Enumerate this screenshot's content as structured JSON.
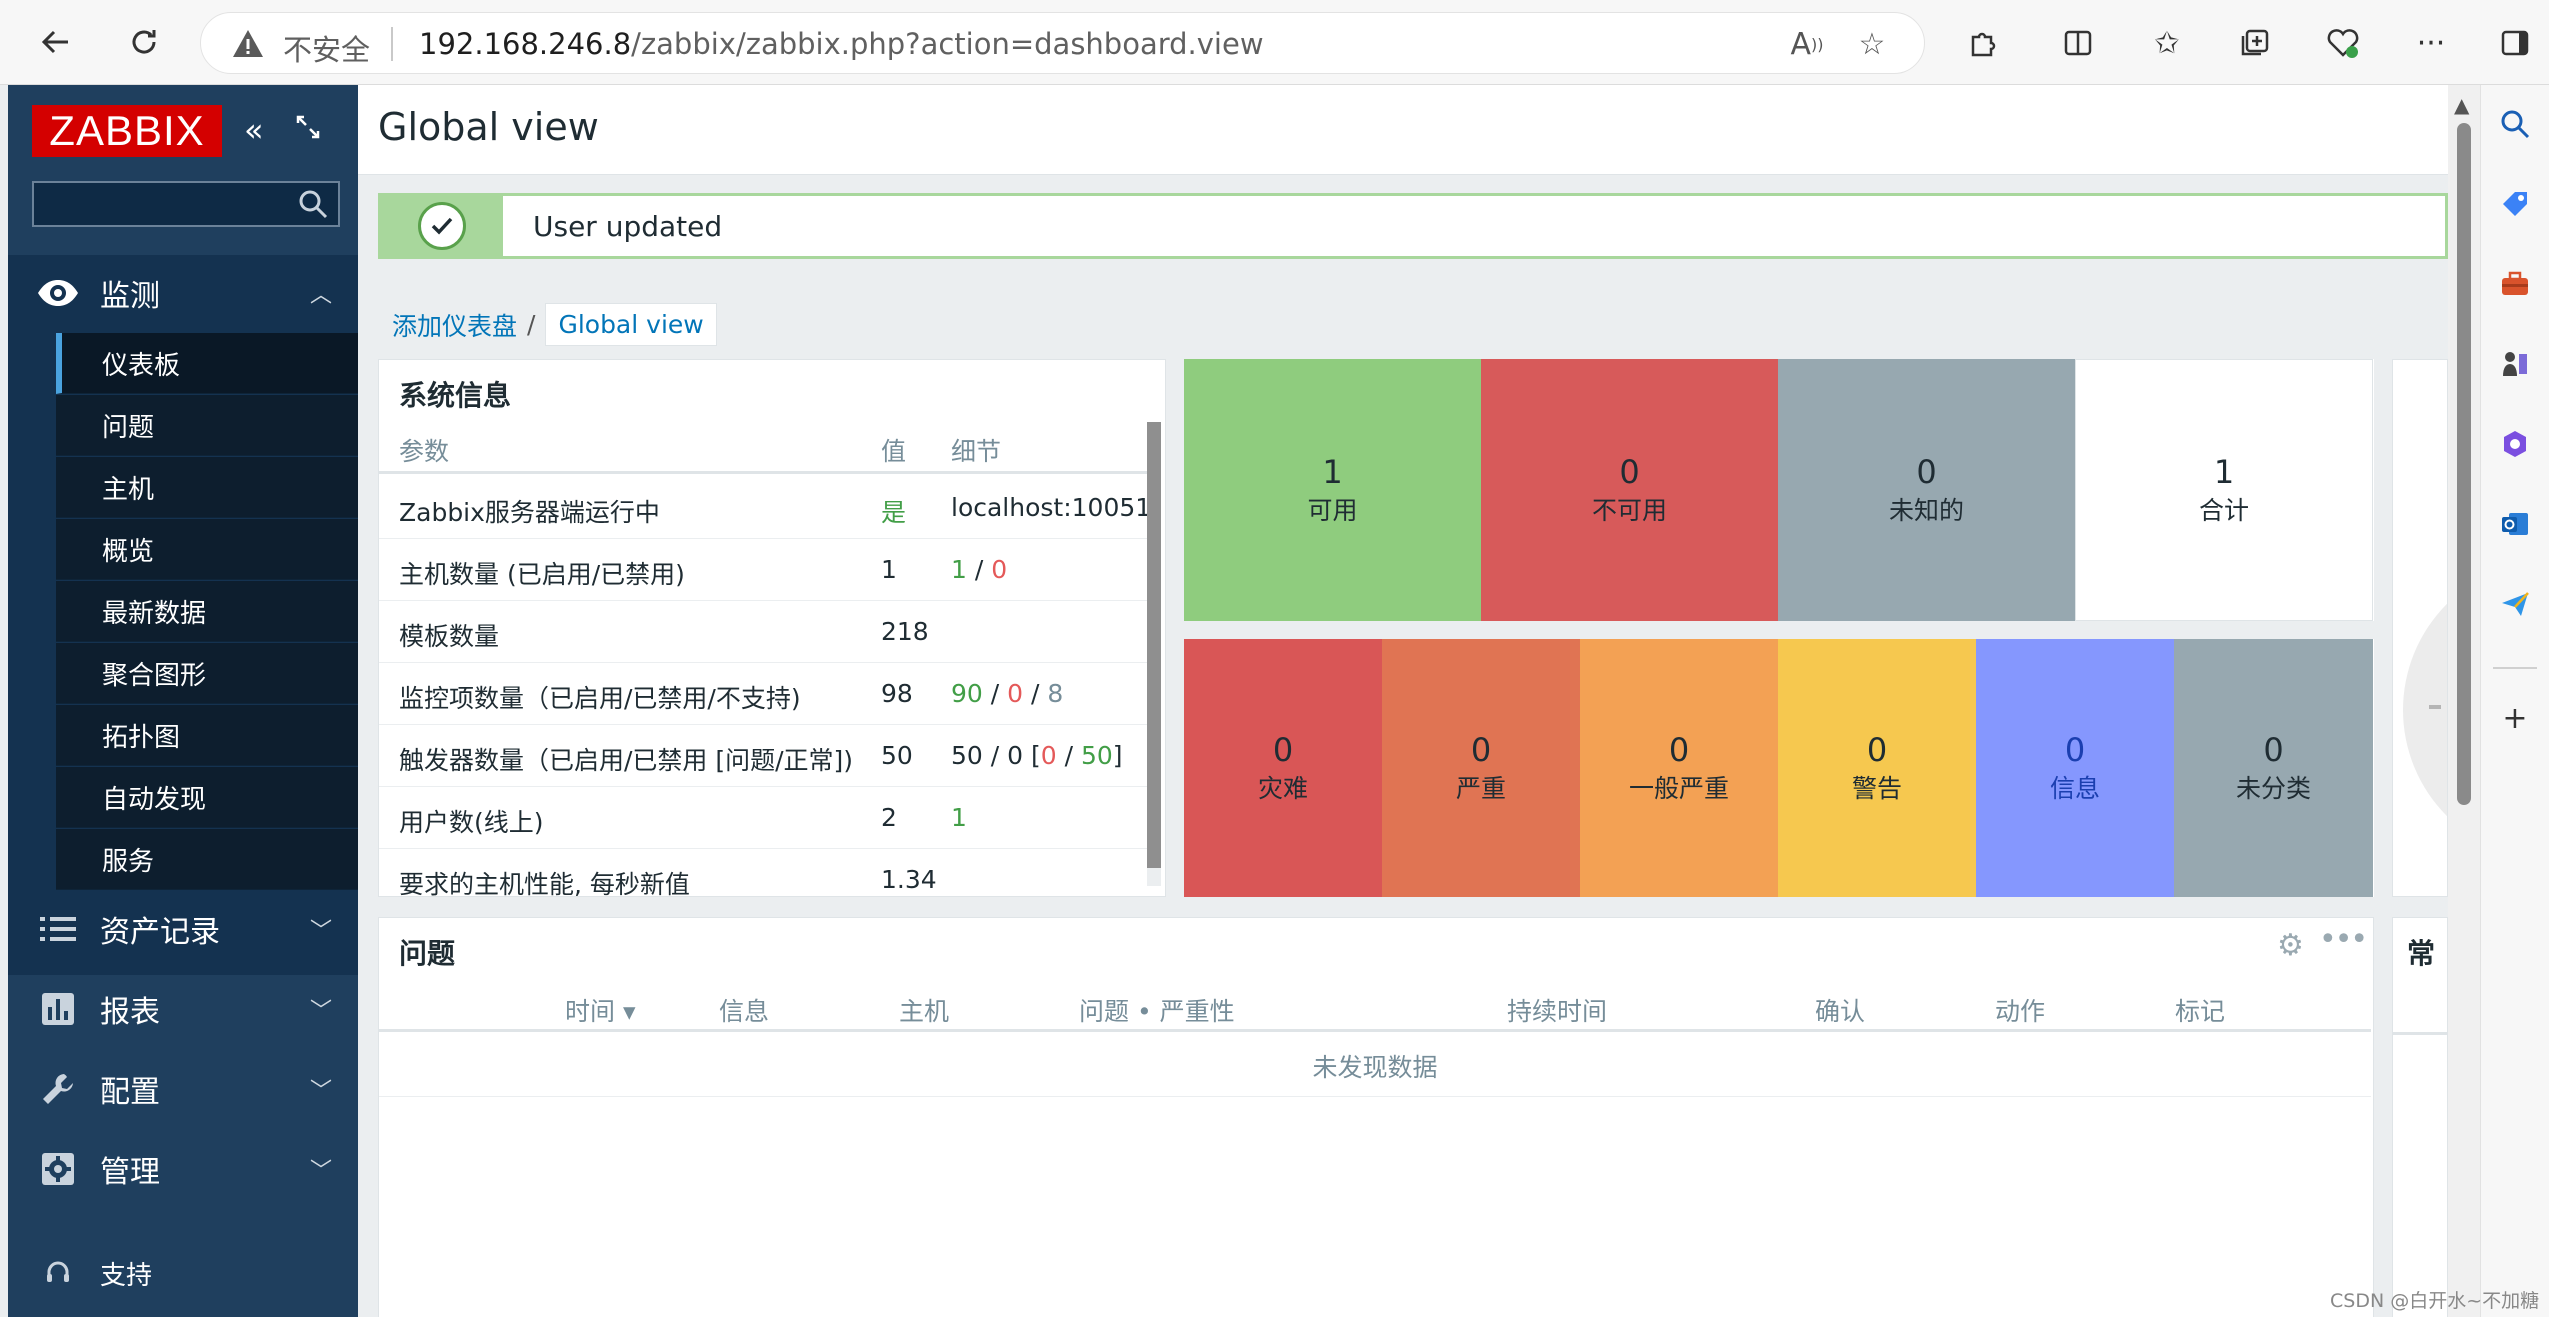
{
  "browser": {
    "insecure_label": "不安全",
    "url_host": "192.168.246.8",
    "url_path": "/zabbix/zabbix.php?action=dashboard.view"
  },
  "sidebar": {
    "logo": "ZABBIX",
    "search_placeholder": "",
    "sections": [
      {
        "label": "监测",
        "icon": "eye-icon",
        "expanded": true
      },
      {
        "label": "资产记录",
        "icon": "list-icon"
      },
      {
        "label": "报表",
        "icon": "bar-chart-icon"
      },
      {
        "label": "配置",
        "icon": "wrench-icon"
      },
      {
        "label": "管理",
        "icon": "gear-icon"
      }
    ],
    "monitor_items": [
      "仪表板",
      "问题",
      "主机",
      "概览",
      "最新数据",
      "聚合图形",
      "拓扑图",
      "自动发现",
      "服务"
    ],
    "support": "支持"
  },
  "header": {
    "title": "Global view"
  },
  "message": {
    "text": "User updated"
  },
  "breadcrumb": {
    "parent": "添加仪表盘",
    "current": "Global view"
  },
  "system_info": {
    "title": "系统信息",
    "columns": [
      "参数",
      "值",
      "细节"
    ],
    "rows": [
      {
        "param": "Zabbix服务器端运行中",
        "value": "是",
        "detail": "localhost:10051"
      },
      {
        "param": "主机数量 (已启用/已禁用)",
        "value": "1",
        "d1": "1",
        "d2": "0"
      },
      {
        "param": "模板数量",
        "value": "218"
      },
      {
        "param": "监控项数量（已启用/已禁用/不支持)",
        "value": "98",
        "d1": "90",
        "d2": "0",
        "d3": "8"
      },
      {
        "param": "触发器数量（已启用/已禁用 [问题/正常])",
        "value": "50",
        "d_prefix": "50 / 0 [",
        "d1": "0",
        "d2": "50",
        "d_suffix": "]"
      },
      {
        "param": "用户数(线上)",
        "value": "2",
        "d1": "1"
      },
      {
        "param": "要求的主机性能, 每秒新值",
        "value": "1.34"
      }
    ]
  },
  "host_availability": {
    "cells": [
      {
        "count": "1",
        "label": "可用",
        "color": "#8fcc7e"
      },
      {
        "count": "0",
        "label": "不可用",
        "color": "#d75a5a"
      },
      {
        "count": "0",
        "label": "未知的",
        "color": "#97a8b0"
      },
      {
        "count": "1",
        "label": "合计",
        "color": "#ffffff"
      }
    ]
  },
  "problems_severity": {
    "cells": [
      {
        "count": "0",
        "label": "灾难",
        "color": "#d95656"
      },
      {
        "count": "0",
        "label": "严重",
        "color": "#e07453"
      },
      {
        "count": "0",
        "label": "一般严重",
        "color": "#f3a154"
      },
      {
        "count": "0",
        "label": "警告",
        "color": "#f6c84f"
      },
      {
        "count": "0",
        "label": "信息",
        "color": "#8597fe"
      },
      {
        "count": "0",
        "label": "未分类",
        "color": "#97a8b0"
      }
    ]
  },
  "problems": {
    "title": "问题",
    "columns": [
      "时间 ▾",
      "信息",
      "主机",
      "问题 • 严重性",
      "持续时间",
      "确认",
      "动作",
      "标记"
    ],
    "empty_text": "未发现数据"
  },
  "right_widget": {
    "title": "常"
  },
  "watermark": "CSDN @白开水~不加糖"
}
